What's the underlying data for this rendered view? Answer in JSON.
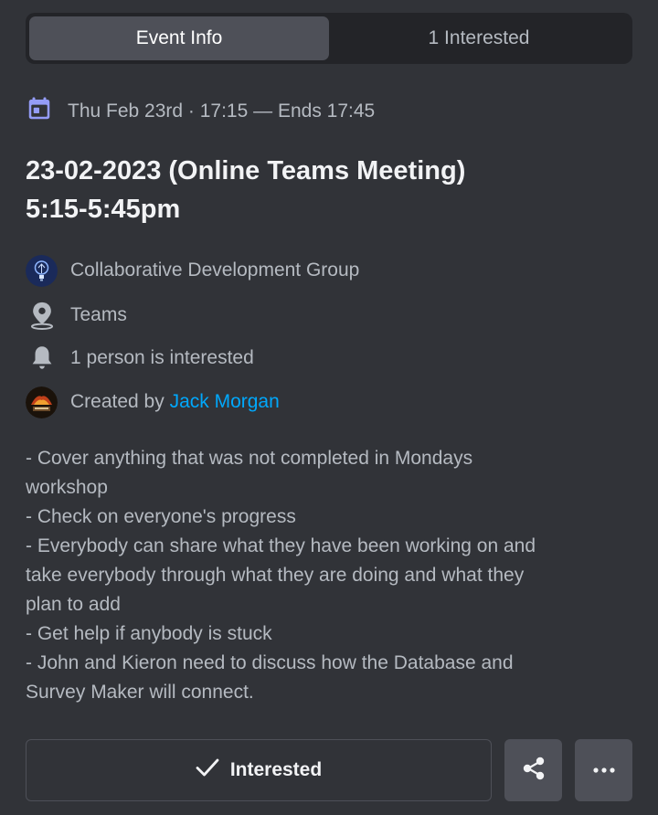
{
  "tabs": [
    {
      "label": "Event Info",
      "active": true
    },
    {
      "label": "1 Interested",
      "active": false
    }
  ],
  "event": {
    "date_text": "Thu Feb 23rd · 17:15 — Ends 17:45",
    "title_line1": "23-02-2023 (Online Teams Meeting)",
    "title_line2": "5:15-5:45pm",
    "server_name": "Collaborative Development Group",
    "location": "Teams",
    "interested_text": "1 person is interested",
    "created_by_prefix": "Created by",
    "creator_name": "Jack Morgan",
    "description": [
      "- Cover anything that was not completed in Mondays",
      "workshop",
      "- Check on everyone's progress",
      "- Everybody can share what they have been working on and",
      "take everybody through what they are doing and what they",
      "plan to add",
      "- Get help if anybody is stuck",
      "- John and Kieron need to discuss how the Database and",
      "Survey Maker will connect."
    ]
  },
  "actions": {
    "interested_label": "Interested",
    "share_icon": "share-icon",
    "more_icon": "more-options-icon"
  },
  "colors": {
    "background": "#313338",
    "accent_link": "#00a8fc",
    "calendar_icon": "#949cf7"
  }
}
